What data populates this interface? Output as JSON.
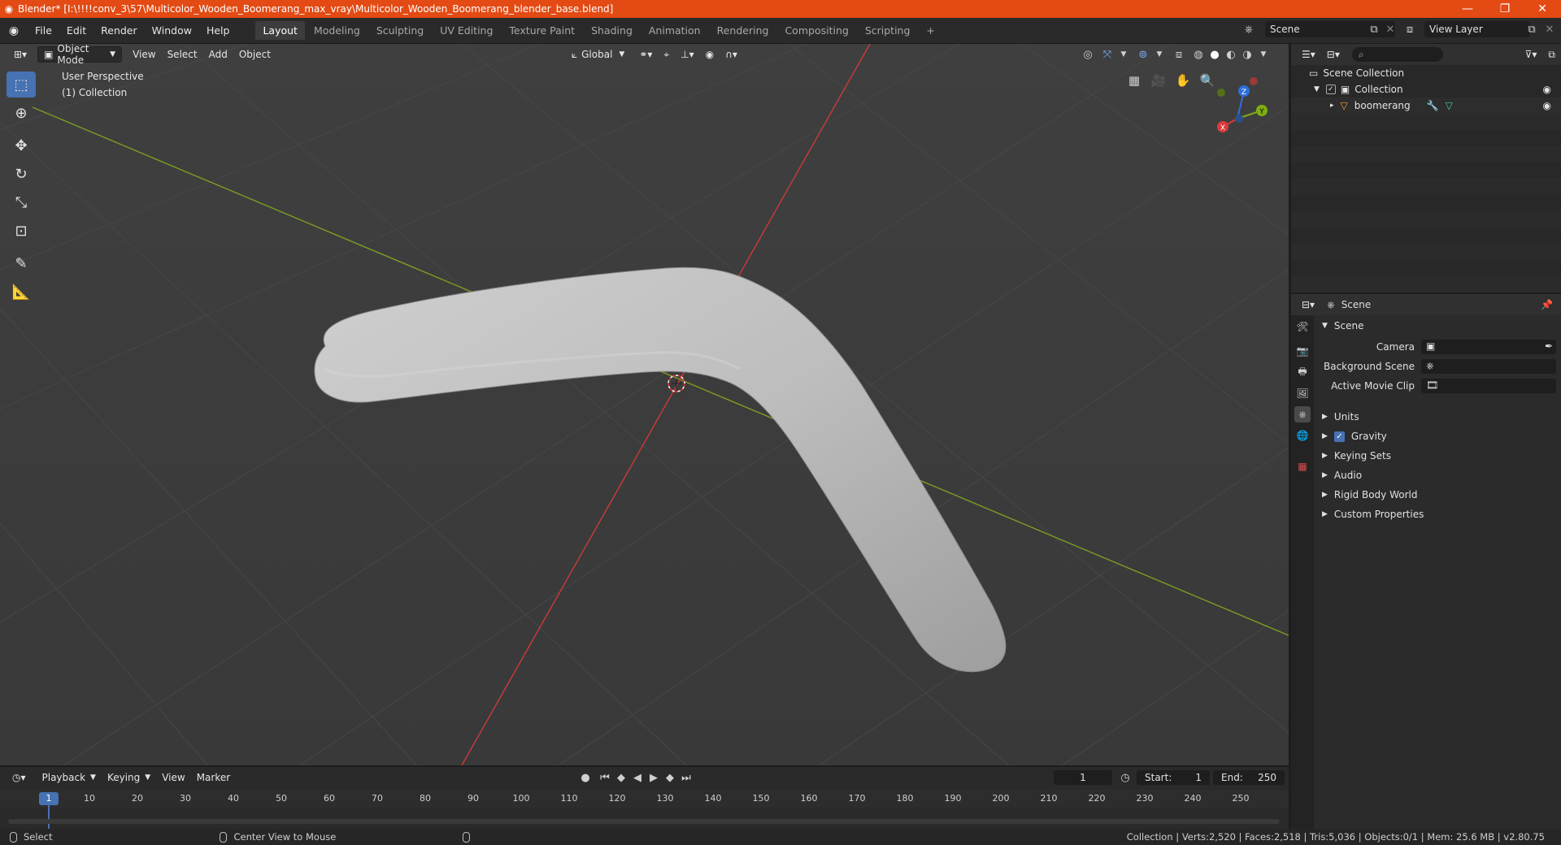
{
  "window": {
    "title": "Blender* [I:\\!!!!conv_3\\57\\Multicolor_Wooden_Boomerang_max_vray\\Multicolor_Wooden_Boomerang_blender_base.blend]",
    "minimize": "—",
    "restore": "❐",
    "close": "✕"
  },
  "menu": [
    "File",
    "Edit",
    "Render",
    "Window",
    "Help"
  ],
  "workspaces": [
    "Layout",
    "Modeling",
    "Sculpting",
    "UV Editing",
    "Texture Paint",
    "Shading",
    "Animation",
    "Rendering",
    "Compositing",
    "Scripting"
  ],
  "active_workspace": "Layout",
  "add_workspace": "+",
  "scene_name": "Scene",
  "view_layer_name": "View Layer",
  "viewport": {
    "mode": "Object Mode",
    "menus": [
      "View",
      "Select",
      "Add",
      "Object"
    ],
    "transform_orientation": "Global",
    "perspective_label": "User Perspective",
    "collection_label": "(1) Collection",
    "gizmo": {
      "x": "X",
      "y": "Y",
      "z": "Z"
    }
  },
  "outliner": {
    "root": "Scene Collection",
    "collection": "Collection",
    "object": "boomerang"
  },
  "properties": {
    "header": "Scene",
    "panel_title": "Scene",
    "camera_label": "Camera",
    "background_scene_label": "Background Scene",
    "active_movie_clip_label": "Active Movie Clip",
    "subpanels": [
      "Units",
      "Gravity",
      "Keying Sets",
      "Audio",
      "Rigid Body World",
      "Custom Properties"
    ],
    "gravity_checked": true
  },
  "timeline": {
    "menus": [
      "Playback",
      "Keying",
      "View",
      "Marker"
    ],
    "current_frame": "1",
    "start_label": "Start:",
    "start_value": "1",
    "end_label": "End:",
    "end_value": "250",
    "ruler_current": "1",
    "ruler_ticks": [
      "10",
      "20",
      "30",
      "40",
      "50",
      "60",
      "70",
      "80",
      "90",
      "100",
      "110",
      "120",
      "130",
      "140",
      "150",
      "160",
      "170",
      "180",
      "190",
      "200",
      "210",
      "220",
      "230",
      "240",
      "250"
    ]
  },
  "statusbar": {
    "select": "Select",
    "center_view": "Center View to Mouse",
    "stats": "Collection | Verts:2,520 | Faces:2,518 | Tris:5,036 | Objects:0/1 | Mem: 25.6 MB | v2.80.75"
  },
  "colors": {
    "titlebar": "#e34a14",
    "accent_blue": "#4772b3",
    "x_axis_red": "#cc3a3a",
    "y_axis_green": "#7c9e22",
    "viewport_bg": "#3d3d3d"
  }
}
